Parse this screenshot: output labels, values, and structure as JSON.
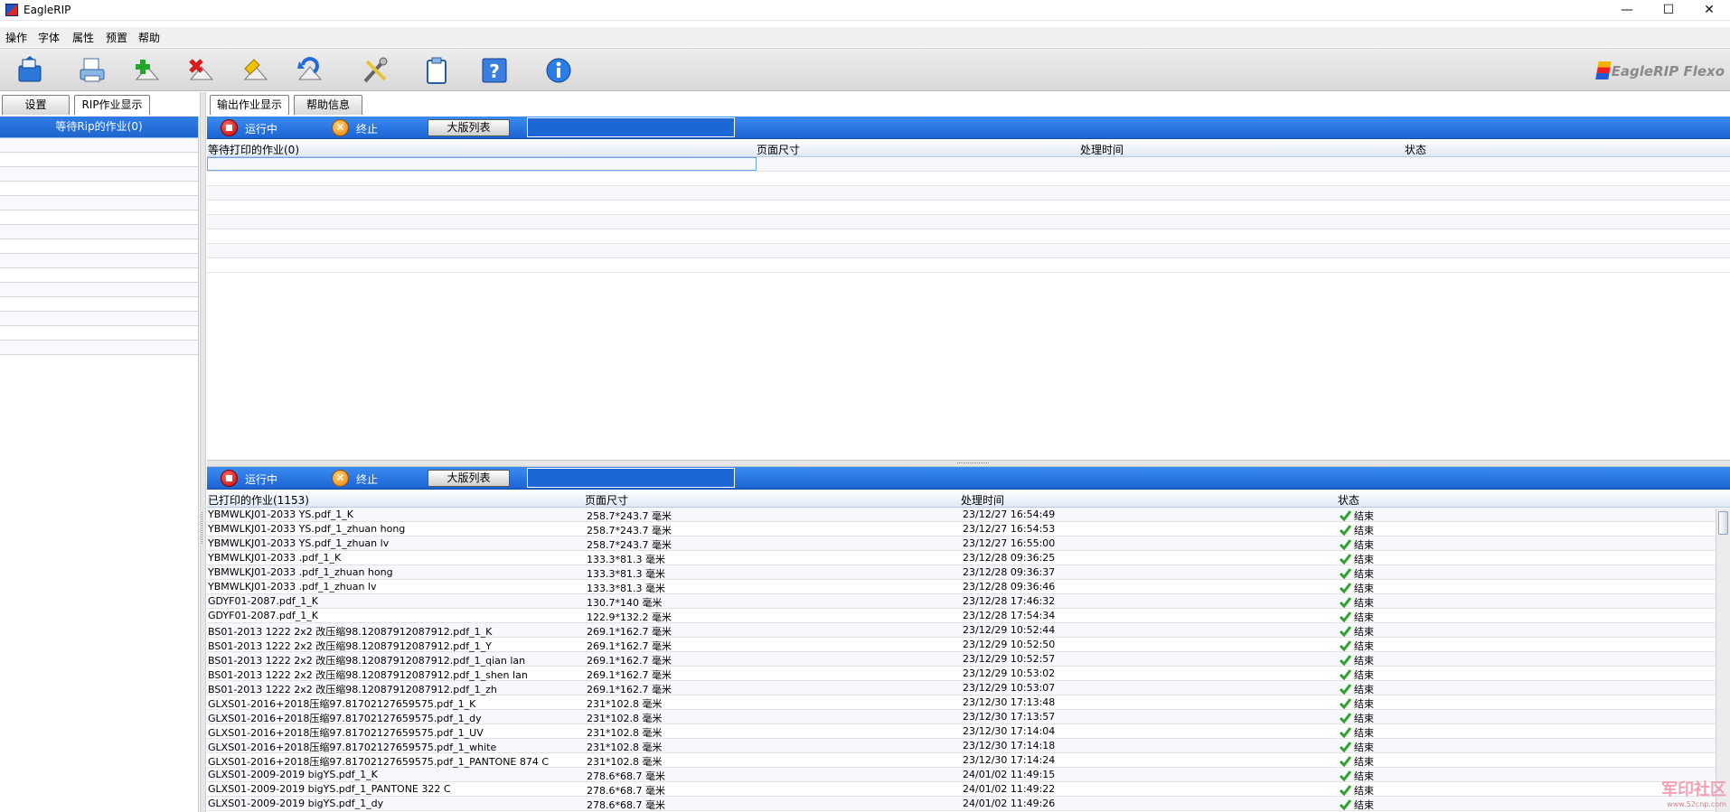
{
  "window": {
    "title": "EagleRIP",
    "controls": [
      "—",
      "☐",
      "✕"
    ]
  },
  "menu": [
    "操作",
    "字体",
    "属性",
    "预置",
    "帮助"
  ],
  "toolbar": {
    "buttons": [
      "open-icon",
      "print-icon",
      "add-icon",
      "delete-icon",
      "edit-icon",
      "undo-icon",
      "tools-icon",
      "clipboard-icon",
      "help-icon",
      "info-icon"
    ],
    "brand": "EagleRIP Flexo"
  },
  "left_tabs": [
    "设置",
    "RIP作业显示"
  ],
  "right_tabs": [
    "输出作业显示",
    "帮助信息"
  ],
  "left_panel": {
    "header": "等待Rip的作业(0)"
  },
  "queue_bar": {
    "running": "运行中",
    "stop": "终止",
    "list_button": "大版列表"
  },
  "top_table": {
    "columns": [
      "等待打印的作业(0)",
      "页面尺寸",
      "处理时间",
      "状态"
    ]
  },
  "bottom_table": {
    "columns": [
      "已打印的作业(1153)",
      "页面尺寸",
      "处理时间",
      "状态"
    ],
    "rows": [
      [
        "YBMWLKJ01-2033 YS.pdf_1_K",
        "258.7*243.7 毫米",
        "23/12/27 16:54:49",
        "结束"
      ],
      [
        "YBMWLKJ01-2033 YS.pdf_1_zhuan hong",
        "258.7*243.7 毫米",
        "23/12/27 16:54:53",
        "结束"
      ],
      [
        "YBMWLKJ01-2033 YS.pdf_1_zhuan lv",
        "258.7*243.7 毫米",
        "23/12/27 16:55:00",
        "结束"
      ],
      [
        "YBMWLKJ01-2033 .pdf_1_K",
        "133.3*81.3 毫米",
        "23/12/28 09:36:25",
        "结束"
      ],
      [
        "YBMWLKJ01-2033 .pdf_1_zhuan hong",
        "133.3*81.3 毫米",
        "23/12/28 09:36:37",
        "结束"
      ],
      [
        "YBMWLKJ01-2033 .pdf_1_zhuan lv",
        "133.3*81.3 毫米",
        "23/12/28 09:36:46",
        "结束"
      ],
      [
        "GDYF01-2087.pdf_1_K",
        "130.7*140 毫米",
        "23/12/28 17:46:32",
        "结束"
      ],
      [
        "GDYF01-2087.pdf_1_K",
        "122.9*132.2 毫米",
        "23/12/28 17:54:34",
        "结束"
      ],
      [
        "BS01-2013 1222 2x2 改压缩98.12087912087912.pdf_1_K",
        "269.1*162.7 毫米",
        "23/12/29 10:52:44",
        "结束"
      ],
      [
        "BS01-2013 1222 2x2 改压缩98.12087912087912.pdf_1_Y",
        "269.1*162.7 毫米",
        "23/12/29 10:52:50",
        "结束"
      ],
      [
        "BS01-2013 1222 2x2 改压缩98.12087912087912.pdf_1_qian lan",
        "269.1*162.7 毫米",
        "23/12/29 10:52:57",
        "结束"
      ],
      [
        "BS01-2013 1222 2x2 改压缩98.12087912087912.pdf_1_shen lan",
        "269.1*162.7 毫米",
        "23/12/29 10:53:02",
        "结束"
      ],
      [
        "BS01-2013 1222 2x2 改压缩98.12087912087912.pdf_1_zh",
        "269.1*162.7 毫米",
        "23/12/29 10:53:07",
        "结束"
      ],
      [
        "GLXS01-2016+2018压缩97.81702127659575.pdf_1_K",
        "231*102.8 毫米",
        "23/12/30 17:13:48",
        "结束"
      ],
      [
        "GLXS01-2016+2018压缩97.81702127659575.pdf_1_dy",
        "231*102.8 毫米",
        "23/12/30 17:13:57",
        "结束"
      ],
      [
        "GLXS01-2016+2018压缩97.81702127659575.pdf_1_UV",
        "231*102.8 毫米",
        "23/12/30 17:14:04",
        "结束"
      ],
      [
        "GLXS01-2016+2018压缩97.81702127659575.pdf_1_white",
        "231*102.8 毫米",
        "23/12/30 17:14:18",
        "结束"
      ],
      [
        "GLXS01-2016+2018压缩97.81702127659575.pdf_1_PANTONE 874 C",
        "231*102.8 毫米",
        "23/12/30 17:14:24",
        "结束"
      ],
      [
        "GLXS01-2009-2019 bigYS.pdf_1_K",
        "278.6*68.7 毫米",
        "24/01/02 11:49:15",
        "结束"
      ],
      [
        "GLXS01-2009-2019 bigYS.pdf_1_PANTONE 322 C",
        "278.6*68.7 毫米",
        "24/01/02 11:49:22",
        "结束"
      ],
      [
        "GLXS01-2009-2019 bigYS.pdf_1_dy",
        "278.6*68.7 毫米",
        "24/01/02 11:49:26",
        "结束"
      ]
    ]
  },
  "watermark": {
    "text": "军印社区",
    "url": "www.52cnp.com"
  },
  "colors": {
    "accent_blue": "#1f6ad8",
    "check_green": "#2fa12f"
  }
}
